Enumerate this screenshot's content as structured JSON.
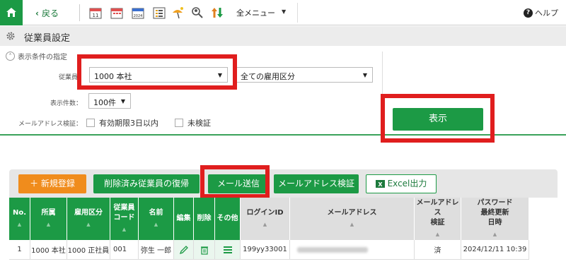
{
  "nav": {
    "back_label": "戻る",
    "menu_label": "全メニュー",
    "help_label": "ヘルプ",
    "tools": [
      "calendar-icon",
      "calendar-check-icon",
      "calendar-2024-icon",
      "list-icon",
      "vacation-icon",
      "user-search-icon",
      "sort-arrows-icon"
    ]
  },
  "page": {
    "title": "従業員設定"
  },
  "filter": {
    "section_label": "表示条件の指定",
    "employee_label": "従業員",
    "employee_value": "1000 本社",
    "employment_value": "全ての雇用区分",
    "count_label": "表示件数：",
    "count_value": "100件",
    "email_label": "メールアドレス検証：",
    "check_expiry": "有効期限3日以内",
    "check_unverified": "未検証",
    "show_button": "表示"
  },
  "actions": {
    "new": "＋ 新規登録",
    "restore": "削除済み従業員の復帰",
    "send_mail": "メール送信",
    "verify_mail": "メールアドレス検証",
    "excel": "Excel出力"
  },
  "table": {
    "headers": [
      "No.",
      "所属",
      "雇用区分",
      "従業員\nコード",
      "名前",
      "編集",
      "削除",
      "その他",
      "ログインID",
      "メールアドレス",
      "メールアドレス\n検証",
      "パスワード\n最終更新\n日時"
    ],
    "rows": [
      {
        "no": "1",
        "dept": "1000 本社",
        "type": "1000 正社員",
        "code": "001",
        "name": "弥生 一郎",
        "login": "199yy33001",
        "verified": "済",
        "updated": "2024/12/11 10:39"
      }
    ]
  },
  "colors": {
    "accent": "#1c9a45",
    "highlight": "#e01e1e",
    "excel": "#1c7a3c",
    "new_button": "#f08c1c"
  }
}
